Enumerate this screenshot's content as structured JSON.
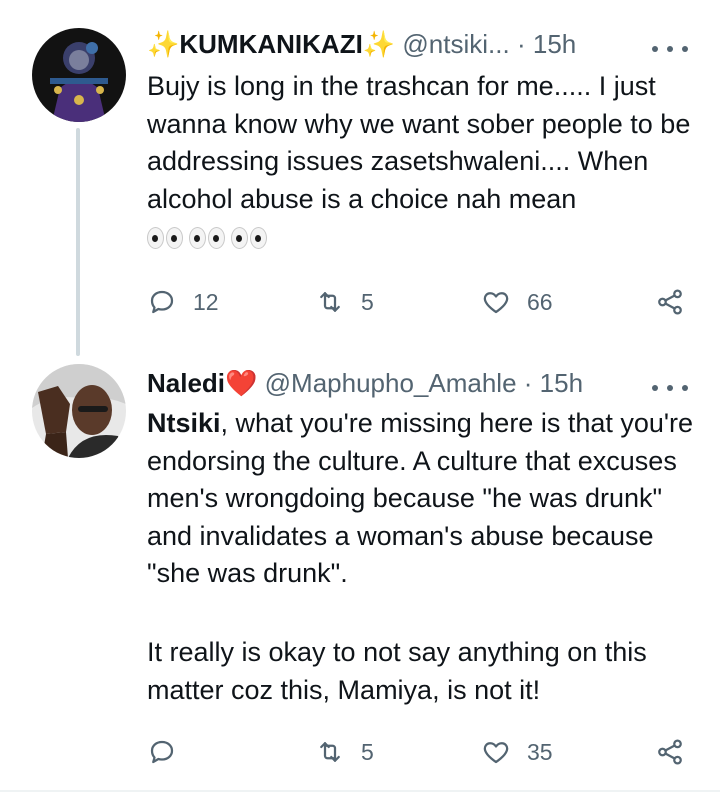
{
  "tweets": [
    {
      "avatar_icon": "avatar-illustrated-portrait",
      "name_prefix": "✨",
      "name": "KUMKANIKAZI",
      "name_suffix": "✨",
      "handle": "@ntsiki...",
      "separator": "·",
      "time": "15h",
      "text": "Bujy is long in the trashcan for me..... I just wanna know why we want sober people to be addressing issues zasetshwaleni.... When alcohol abuse is a choice nah mean",
      "emoji": "👀👀👀",
      "reply_count": "12",
      "retweet_count": "5",
      "like_count": "66"
    },
    {
      "avatar_icon": "avatar-photo-portrait",
      "name": "Naledi",
      "name_suffix": "❤️",
      "handle": "@Maphupho_Amahle",
      "separator": "·",
      "time": "15h",
      "mention": "Ntsiki",
      "text_after_mention": ", what you're missing here is that you're endorsing the culture. A culture that excuses men's wrongdoing because \"he was drunk\" and invalidates a woman's abuse because \"she was drunk\".",
      "text_p2": "It really is okay to not say anything on this matter coz this, Mamiya, is not it!",
      "reply_count": "",
      "retweet_count": "5",
      "like_count": "35"
    }
  ],
  "icons": [
    "reply-icon",
    "retweet-icon",
    "like-icon",
    "share-icon",
    "more-icon"
  ],
  "colors": {
    "text": "#0f1419",
    "secondary": "#536471",
    "thread_line": "#cfd9de",
    "sparkle": "#f5b82e",
    "heart": "#e0245e"
  }
}
